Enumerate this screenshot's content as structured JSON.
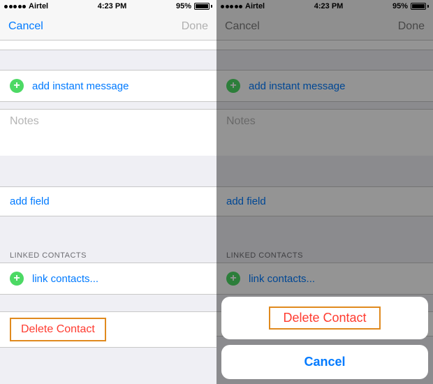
{
  "status": {
    "carrier": "Airtel",
    "time": "4:23 PM",
    "battery_pct": "95%"
  },
  "nav": {
    "cancel": "Cancel",
    "done": "Done"
  },
  "rows": {
    "add_im": "add instant message",
    "notes": "Notes",
    "add_field": "add field",
    "linked_header": "LINKED CONTACTS",
    "link_contacts": "link contacts...",
    "delete_contact": "Delete Contact"
  },
  "sheet": {
    "delete": "Delete Contact",
    "cancel": "Cancel"
  },
  "icons": {
    "plus": "+"
  }
}
